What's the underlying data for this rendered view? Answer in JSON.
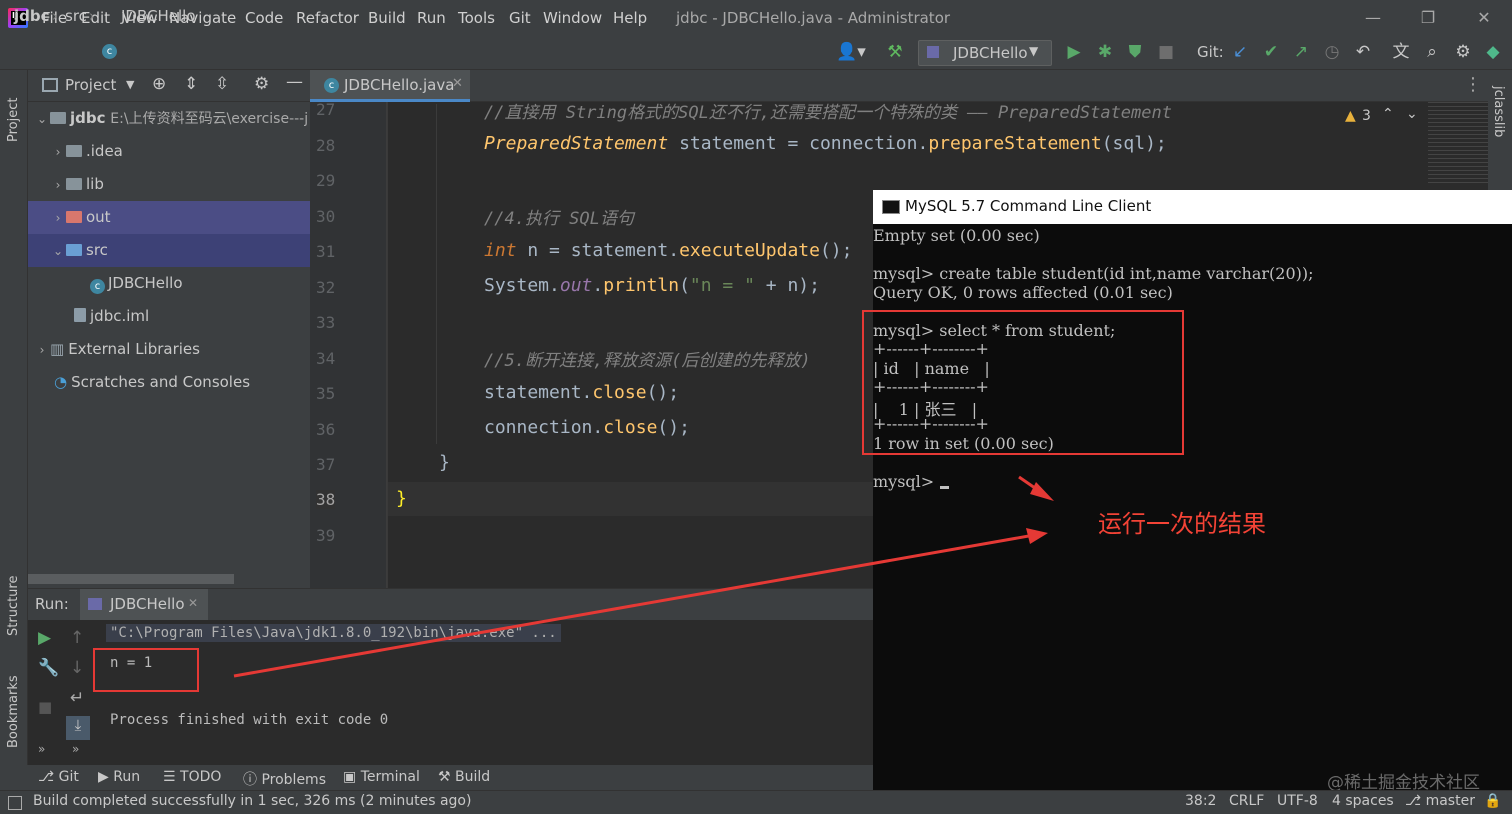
{
  "app": {
    "menus": [
      "File",
      "Edit",
      "View",
      "Navigate",
      "Code",
      "Refactor",
      "Build",
      "Run",
      "Tools",
      "Git",
      "Window",
      "Help"
    ],
    "window_title": "jdbc - JDBCHello.java - Administrator",
    "window_controls": [
      "minimize-icon",
      "restore-icon",
      "close-icon"
    ]
  },
  "navbar": {
    "breadcrumb": [
      "jdbc",
      "src",
      "JDBCHello"
    ],
    "run_config": "JDBCHello",
    "git_label": "Git:"
  },
  "left_strip": {
    "project": "Project",
    "structure": "Structure",
    "bookmarks": "Bookmarks"
  },
  "project_panel": {
    "title": "Project",
    "tree": [
      {
        "label": "jdbc",
        "extra": "E:\\上传资料至码云\\exercise---j",
        "icon": "folder-icon"
      },
      {
        "label": ".idea",
        "icon": "folder-icon"
      },
      {
        "label": "lib",
        "icon": "folder-icon"
      },
      {
        "label": "out",
        "icon": "folder-icon"
      },
      {
        "label": "src",
        "icon": "folder-icon"
      },
      {
        "label": "JDBCHello",
        "icon": "java-class-icon"
      },
      {
        "label": "jdbc.iml",
        "icon": "module-file-icon"
      },
      {
        "label": "External Libraries",
        "icon": "library-icon"
      },
      {
        "label": "Scratches and Consoles",
        "icon": "scratches-icon"
      }
    ]
  },
  "editor": {
    "tab": "JDBCHello.java",
    "line_numbers": [
      "27",
      "28",
      "29",
      "30",
      "31",
      "32",
      "33",
      "34",
      "35",
      "36",
      "37",
      "38",
      "39"
    ],
    "current_line": "38",
    "warnings": "3",
    "right_label": "jclasslib",
    "code": {
      "l27_comment": "//直接用 String格式的SQL还不行,还需要搭配一个特殊的类 —— PreparedStatement",
      "l28_type": "PreparedStatement",
      "l28_var": " statement = connection.",
      "l28_method": "prepareStatement",
      "l28_end": "(sql);",
      "l30_comment": "//4.执行 SQL语句",
      "l31_kw": "int",
      "l31_a": " n = statement.",
      "l31_method": "executeUpdate",
      "l31_end": "();",
      "l32_a": "System.",
      "l32_field": "out",
      "l32_dot": ".",
      "l32_method": "println",
      "l32_open": "(",
      "l32_str": "\"n = \"",
      "l32_end": " + n);",
      "l34_comment": "//5.断开连接,释放资源(后创建的先释放)",
      "l35_a": "statement.",
      "l35_method": "close",
      "l35_end": "();",
      "l36_a": "connection.",
      "l36_method": "close",
      "l36_end": "();",
      "l37_brace": "}",
      "l38_brace": "}"
    }
  },
  "mysql": {
    "title": "MySQL 5.7 Command Line Client",
    "lines": [
      "Empty set (0.00 sec)",
      "",
      "mysql> create table student(id int,name varchar(20));",
      "Query OK, 0 rows affected (0.01 sec)",
      "",
      "mysql> select * from student;",
      "+------+--------+",
      "| id   | name   |",
      "+------+--------+",
      "|    1 | 张三   |",
      "+------+--------+",
      "1 row in set (0.00 sec)",
      "",
      "mysql> "
    ],
    "annotation": "运行一次的结果",
    "watermark": "@稀土掘金技术社区"
  },
  "run_panel": {
    "label": "Run:",
    "tab": "JDBCHello",
    "command": "\"C:\\Program Files\\Java\\jdk1.8.0_192\\bin\\java.exe\" ...",
    "output": "n = 1",
    "finished": "Process finished with exit code 0"
  },
  "tool_windows": [
    "Git",
    "Run",
    "TODO",
    "Problems",
    "Terminal",
    "Build"
  ],
  "status": {
    "message": "Build completed successfully in 1 sec, 326 ms (2 minutes ago)",
    "position": "38:2",
    "line_sep": "CRLF",
    "encoding": "UTF-8",
    "indent": "4 spaces",
    "branch": "master"
  }
}
